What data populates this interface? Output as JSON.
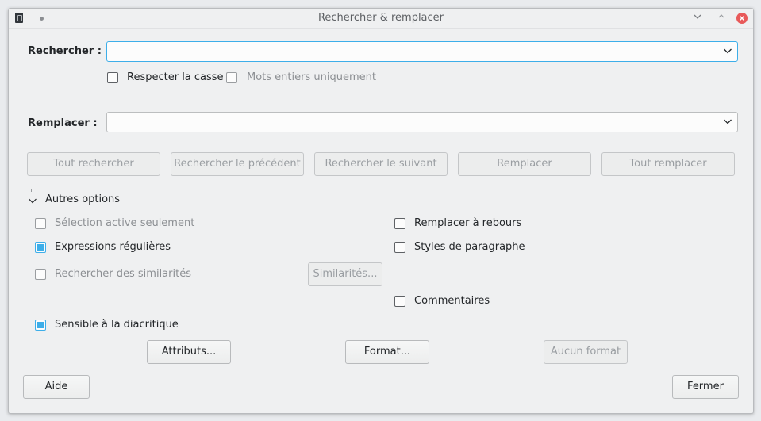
{
  "window": {
    "title": "Rechercher & remplacer"
  },
  "search": {
    "label": "Rechercher :",
    "value": "",
    "match_case": {
      "label": "Respecter la casse",
      "checked": false
    },
    "whole_words": {
      "label": "Mots entiers uniquement",
      "checked": false,
      "enabled": false
    }
  },
  "replace": {
    "label": "Remplacer :",
    "value": ""
  },
  "actions": {
    "find_all": "Tout rechercher",
    "find_prev": "Rechercher le précédent",
    "find_next": "Rechercher le suivant",
    "replace": "Remplacer",
    "replace_all": "Tout remplacer"
  },
  "other_options": {
    "label": "Autres options",
    "expanded": true,
    "current_selection_only": {
      "label": "Sélection active seulement",
      "checked": false,
      "enabled": false
    },
    "regular_expressions": {
      "label": "Expressions régulières",
      "checked": true
    },
    "similarity_search": {
      "label": "Rechercher des similarités",
      "checked": false,
      "enabled": false
    },
    "similarities_button": "Similarités...",
    "diacritic_sensitive": {
      "label": "Sensible à la diacritique",
      "checked": true
    },
    "replace_backwards": {
      "label": "Remplacer à rebours",
      "checked": false
    },
    "paragraph_styles": {
      "label": "Styles de paragraphe",
      "checked": false
    },
    "comments": {
      "label": "Commentaires",
      "checked": false
    },
    "attributes_button": "Attributs...",
    "format_button": "Format...",
    "no_format_button": "Aucun format"
  },
  "footer": {
    "help": "Aide",
    "close": "Fermer"
  }
}
